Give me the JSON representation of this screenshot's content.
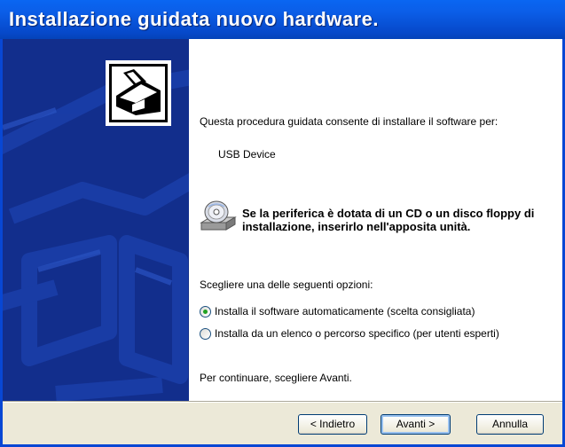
{
  "window": {
    "title": "Installazione guidata nuovo hardware."
  },
  "wizard": {
    "intro": "Questa procedura guidata consente di installare il software per:",
    "device_name": "USB Device",
    "cd_note": "Se la periferica è dotata di un CD o un disco floppy di installazione, inserirlo nell'apposita unità.",
    "choose_prompt": "Scegliere una delle seguenti opzioni:",
    "options": [
      {
        "label": "Installa il software automaticamente (scelta consigliata)",
        "selected": true
      },
      {
        "label": "Installa da un elenco o percorso specifico (per utenti esperti)",
        "selected": false
      }
    ],
    "continue_hint": "Per continuare, scegliere Avanti."
  },
  "buttons": {
    "back": "< Indietro",
    "next": "Avanti >",
    "cancel": "Annulla"
  },
  "icons": {
    "wizard": "hardware-wizard-icon",
    "cd": "cd-drive-icon"
  },
  "colors": {
    "titlebar": "#0054e3",
    "left_panel": "#122e8c",
    "footer": "#ece9d8"
  }
}
